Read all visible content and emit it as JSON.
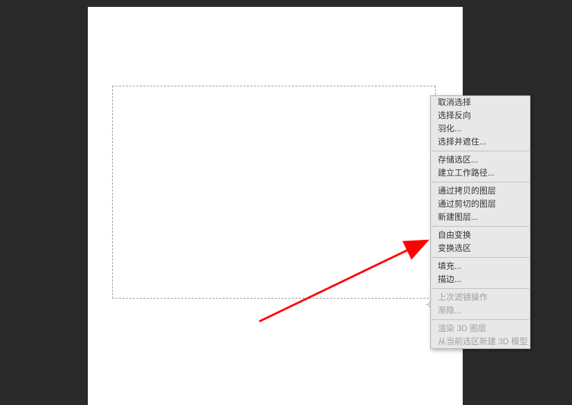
{
  "context_menu": {
    "groups": [
      [
        {
          "label": "取消选择",
          "enabled": true
        },
        {
          "label": "选择反向",
          "enabled": true
        },
        {
          "label": "羽化...",
          "enabled": true
        },
        {
          "label": "选择并遮住...",
          "enabled": true
        }
      ],
      [
        {
          "label": "存储选区...",
          "enabled": true
        },
        {
          "label": "建立工作路径...",
          "enabled": true
        }
      ],
      [
        {
          "label": "通过拷贝的图层",
          "enabled": true
        },
        {
          "label": "通过剪切的图层",
          "enabled": true
        },
        {
          "label": "新建图层...",
          "enabled": true
        }
      ],
      [
        {
          "label": "自由变换",
          "enabled": true
        },
        {
          "label": "变换选区",
          "enabled": true
        }
      ],
      [
        {
          "label": "填充...",
          "enabled": true
        },
        {
          "label": "描边...",
          "enabled": true
        }
      ],
      [
        {
          "label": "上次滤镜操作",
          "enabled": false
        },
        {
          "label": "渐隐...",
          "enabled": false
        }
      ],
      [
        {
          "label": "渲染 3D 图层",
          "enabled": false
        },
        {
          "label": "从当前选区新建 3D 模型",
          "enabled": false
        }
      ]
    ]
  },
  "arrow": {
    "color": "#ff0000"
  }
}
